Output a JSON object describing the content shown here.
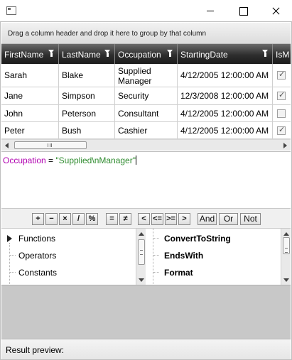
{
  "group_panel": {
    "text": "Drag a column header and drop it here to group by that column"
  },
  "grid": {
    "columns": [
      "FirstName",
      "LastName",
      "Occupation",
      "StartingDate",
      "IsM"
    ],
    "rows": [
      {
        "first": "Sarah",
        "last": "Blake",
        "occupation": "Supplied Manager",
        "date": "4/12/2005 12:00:00 AM",
        "checked": true
      },
      {
        "first": "Jane",
        "last": "Simpson",
        "occupation": "Security",
        "date": "12/3/2008 12:00:00 AM",
        "checked": true
      },
      {
        "first": "John",
        "last": "Peterson",
        "occupation": "Consultant",
        "date": "4/12/2005 12:00:00 AM",
        "checked": false
      },
      {
        "first": "Peter",
        "last": "Bush",
        "occupation": "Cashier",
        "date": "4/12/2005 12:00:00 AM",
        "checked": true
      }
    ]
  },
  "expression": {
    "field": "Occupation",
    "operator": " = ",
    "value": "\"Supplied\\nManager\""
  },
  "toolbar": {
    "plus": "+",
    "minus": "−",
    "multiply": "×",
    "divide": "/",
    "percent": "%",
    "equal": "=",
    "not_equal": "≠",
    "less": "<",
    "less_equal": "<=",
    "greater_equal": ">=",
    "greater": ">",
    "and": "And",
    "or": "Or",
    "not": "Not"
  },
  "categories": [
    "Functions",
    "Operators",
    "Constants"
  ],
  "functions": [
    "ConvertToString",
    "EndsWith",
    "Format"
  ],
  "result": {
    "label": "Result preview:"
  },
  "colors": {
    "header_bg": "#2e2e2e",
    "field": "#b000b0",
    "string": "#2e8b2e",
    "empty_area": "#c8c8c8"
  }
}
